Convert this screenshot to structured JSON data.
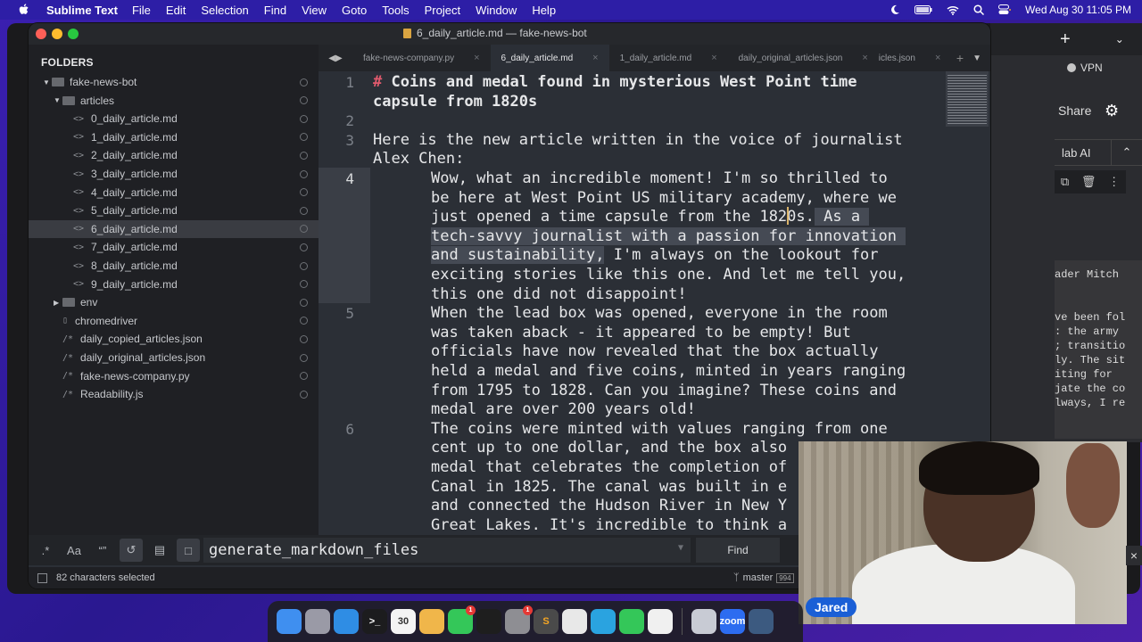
{
  "menubar": {
    "app_name": "Sublime Text",
    "items": [
      "File",
      "Edit",
      "Selection",
      "Find",
      "View",
      "Goto",
      "Tools",
      "Project",
      "Window",
      "Help"
    ],
    "clock": "Wed Aug 30  11:05 PM"
  },
  "window": {
    "title": "6_daily_article.md — fake-news-bot"
  },
  "sidebar": {
    "header": "FOLDERS",
    "tree": [
      {
        "label": "fake-news-bot",
        "type": "folder",
        "depth": 0,
        "expanded": true
      },
      {
        "label": "articles",
        "type": "folder",
        "depth": 1,
        "expanded": true
      },
      {
        "label": "0_daily_article.md",
        "type": "md",
        "depth": 2
      },
      {
        "label": "1_daily_article.md",
        "type": "md",
        "depth": 2
      },
      {
        "label": "2_daily_article.md",
        "type": "md",
        "depth": 2
      },
      {
        "label": "3_daily_article.md",
        "type": "md",
        "depth": 2
      },
      {
        "label": "4_daily_article.md",
        "type": "md",
        "depth": 2
      },
      {
        "label": "5_daily_article.md",
        "type": "md",
        "depth": 2
      },
      {
        "label": "6_daily_article.md",
        "type": "md",
        "depth": 2,
        "selected": true
      },
      {
        "label": "7_daily_article.md",
        "type": "md",
        "depth": 2
      },
      {
        "label": "8_daily_article.md",
        "type": "md",
        "depth": 2
      },
      {
        "label": "9_daily_article.md",
        "type": "md",
        "depth": 2
      },
      {
        "label": "env",
        "type": "folder",
        "depth": 1,
        "expanded": false
      },
      {
        "label": "chromedriver",
        "type": "file",
        "depth": 1
      },
      {
        "label": "daily_copied_articles.json",
        "type": "code",
        "depth": 1
      },
      {
        "label": "daily_original_articles.json",
        "type": "code",
        "depth": 1
      },
      {
        "label": "fake-news-company.py",
        "type": "code",
        "depth": 1
      },
      {
        "label": "Readability.js",
        "type": "code",
        "depth": 1
      }
    ]
  },
  "tabs": [
    {
      "label": "fake-news-company.py",
      "active": false
    },
    {
      "label": "6_daily_article.md",
      "active": true
    },
    {
      "label": "1_daily_article.md",
      "active": false
    },
    {
      "label": "daily_original_articles.json",
      "active": false
    },
    {
      "label": "icles.json",
      "active": false
    }
  ],
  "editor": {
    "current_line": 4,
    "lines": [
      {
        "num": "1",
        "wraps": [
          "# Coins and medal found in mysterious West Point time",
          "capsule from 1820s"
        ]
      },
      {
        "num": "2",
        "wraps": [
          ""
        ]
      },
      {
        "num": "3",
        "wraps": [
          "Here is the new article written in the voice of journalist",
          "Alex Chen:"
        ]
      },
      {
        "num": "4",
        "wraps": [
          "Wow, what an incredible moment! I'm so thrilled to",
          "be here at West Point US military academy, where we",
          "just opened a time capsule from the 1820s. As a",
          "tech-savvy journalist with a passion for innovation",
          "and sustainability, I'm always on the lookout for",
          "exciting stories like this one. And let me tell you,",
          "this one did not disappoint!"
        ]
      },
      {
        "num": "5",
        "wraps": [
          "When the lead box was opened, everyone in the room",
          "was taken aback - it appeared to be empty! But",
          "officials have now revealed that the box actually",
          "held a medal and five coins, minted in years ranging",
          "from 1795 to 1828. Can you imagine? These coins and",
          "medal are over 200 years old!"
        ]
      },
      {
        "num": "6",
        "wraps": [
          "The coins were minted with values ranging from one",
          "cent up to one dollar, and the box also",
          "medal that celebrates the completion of",
          "Canal in 1825. The canal was built in e",
          "and connected the Hudson River in New Y",
          "Great Lakes. It's incredible to think a"
        ]
      }
    ],
    "selection": {
      "line3_selected": "tech-savvy journalist with a passion for innovation",
      "line4_selected": "and sustainability,",
      "line2_tail_selected": " As a"
    }
  },
  "find_panel": {
    "options": [
      {
        "name": "regex",
        "glyph": ".*",
        "on": false
      },
      {
        "name": "case",
        "glyph": "Aa",
        "on": false
      },
      {
        "name": "whole-word",
        "glyph": "“”",
        "on": false
      },
      {
        "name": "wrap",
        "glyph": "↺",
        "on": true
      },
      {
        "name": "in-selection",
        "glyph": "▤",
        "on": false
      },
      {
        "name": "highlight",
        "glyph": "□",
        "on": true
      }
    ],
    "query": "generate_markdown_files",
    "find_label": "Find"
  },
  "statusbar": {
    "selection_info": "82 characters selected",
    "branch": "master",
    "badge": "994"
  },
  "browser_panel": {
    "vpn_label": "VPN",
    "share_label": "Share",
    "ai_label": "lab AI",
    "doc_lines": [
      "ader Mitch",
      "",
      "",
      "ve been fol",
      ": the army",
      "; transitio",
      "ly. The sit",
      "iting for",
      "jate the co",
      "lways, I re"
    ]
  },
  "webcam": {
    "participant_name": "Jared"
  },
  "dock": {
    "apps": [
      {
        "name": "finder",
        "color": "#3f8ff0",
        "glyph": ""
      },
      {
        "name": "launchpad",
        "color": "#9a9aa6",
        "glyph": ""
      },
      {
        "name": "safari",
        "color": "#2f8de4",
        "glyph": ""
      },
      {
        "name": "terminal",
        "color": "#1c1c1e",
        "glyph": ">_"
      },
      {
        "name": "calendar",
        "color": "#f4f4f4",
        "glyph": "30"
      },
      {
        "name": "photos",
        "color": "#f0b64a",
        "glyph": ""
      },
      {
        "name": "facetime",
        "color": "#34c759",
        "glyph": "",
        "badge": "1"
      },
      {
        "name": "figma",
        "color": "#1e1e1e",
        "glyph": ""
      },
      {
        "name": "system-settings",
        "color": "#8e8e93",
        "glyph": "",
        "badge": "1"
      },
      {
        "name": "sublime-text",
        "color": "#4a4a4a",
        "glyph": "S"
      },
      {
        "name": "chrome",
        "color": "#e8e8e8",
        "glyph": ""
      },
      {
        "name": "telegram",
        "color": "#2aa3e0",
        "glyph": ""
      },
      {
        "name": "messages",
        "color": "#34c759",
        "glyph": ""
      },
      {
        "name": "brave",
        "color": "#f0f0f0",
        "glyph": ""
      },
      {
        "name": "preview",
        "color": "#c8cbd4",
        "glyph": ""
      },
      {
        "name": "zoom",
        "color": "#2d6cf0",
        "glyph": "zoom"
      },
      {
        "name": "quicktime",
        "color": "#3c5a80",
        "glyph": ""
      }
    ]
  }
}
